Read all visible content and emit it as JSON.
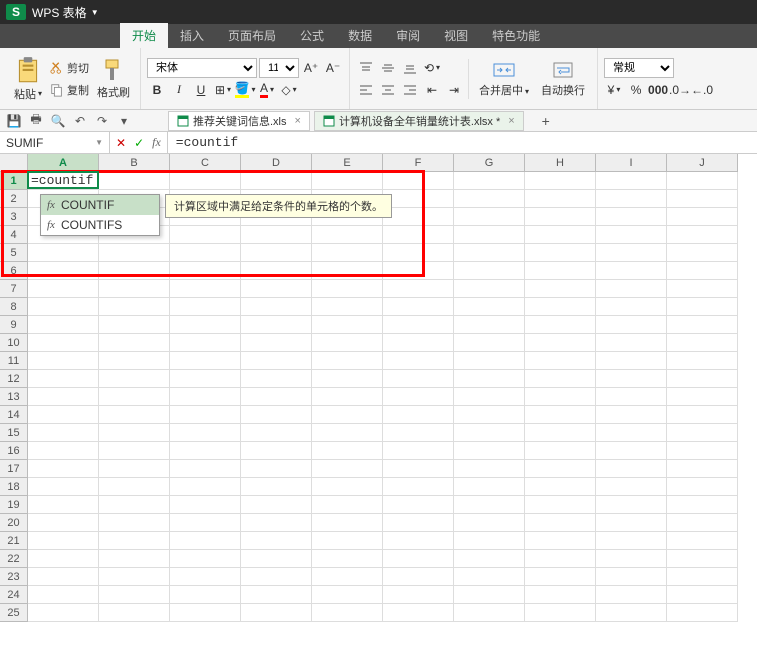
{
  "app": {
    "logo": "S",
    "title": "WPS 表格"
  },
  "menu": {
    "tabs": [
      "开始",
      "插入",
      "页面布局",
      "公式",
      "数据",
      "审阅",
      "视图",
      "特色功能"
    ],
    "active": 0
  },
  "ribbon": {
    "paste": "粘贴",
    "cut": "剪切",
    "copy": "复制",
    "format_painter": "格式刷",
    "font_name": "宋体",
    "font_size": "11",
    "bold": "B",
    "italic": "I",
    "underline": "U",
    "merge_center": "合并居中",
    "wrap_text": "自动换行",
    "number_format": "常规"
  },
  "doctabs": [
    {
      "name": "推荐关键词信息.xls",
      "active": false
    },
    {
      "name": "计算机设备全年销量统计表.xlsx *",
      "active": true
    }
  ],
  "formula_bar": {
    "name_box": "SUMIF",
    "value": "=countif"
  },
  "grid": {
    "cols": [
      "A",
      "B",
      "C",
      "D",
      "E",
      "F",
      "G",
      "H",
      "I",
      "J"
    ],
    "rows": [
      "1",
      "2",
      "3",
      "4",
      "5",
      "6",
      "7",
      "8",
      "9",
      "10",
      "11",
      "12",
      "13",
      "14",
      "15",
      "16",
      "17",
      "18",
      "19",
      "20",
      "21",
      "22",
      "23",
      "24",
      "25"
    ],
    "active_cell_text": "=countif"
  },
  "autocomplete": {
    "items": [
      {
        "name": "COUNTIF",
        "selected": true
      },
      {
        "name": "COUNTIFS",
        "selected": false
      }
    ],
    "tooltip": "计算区域中满足给定条件的单元格的个数。"
  }
}
